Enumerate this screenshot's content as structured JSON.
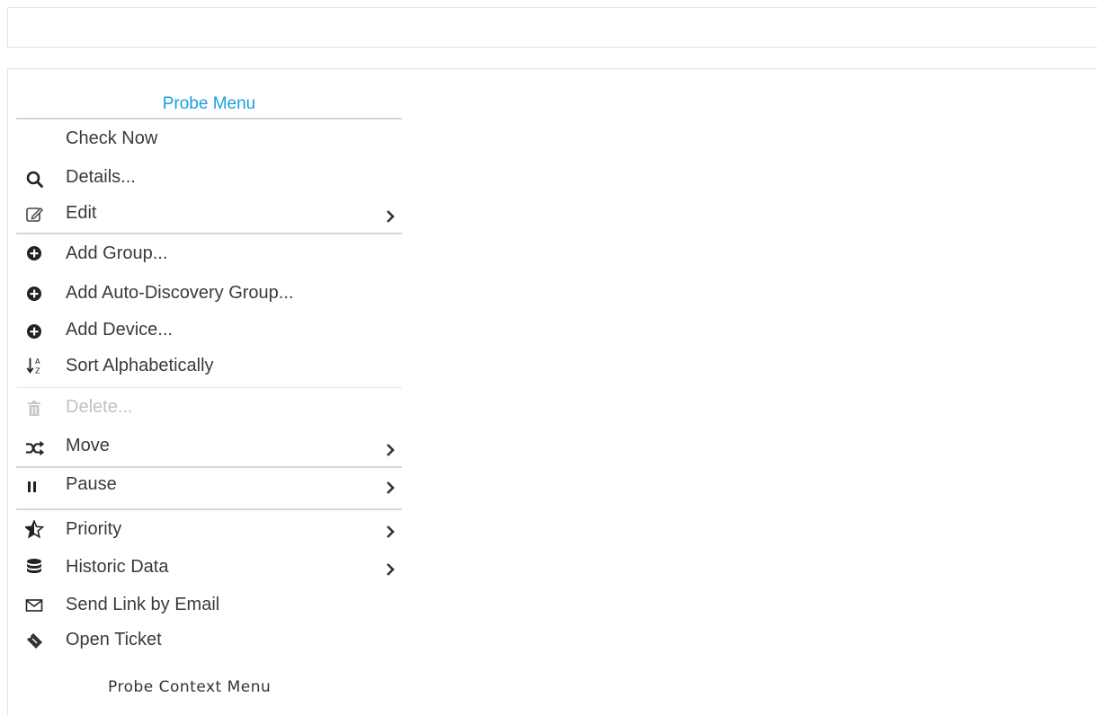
{
  "menu": {
    "title": "Probe Menu",
    "items": [
      {
        "label": "Check Now"
      },
      {
        "label": "Details..."
      },
      {
        "label": "Edit"
      },
      {
        "label": "Add Group..."
      },
      {
        "label": "Add Auto-Discovery Group..."
      },
      {
        "label": "Add Device..."
      },
      {
        "label": "Sort Alphabetically"
      },
      {
        "label": "Delete..."
      },
      {
        "label": "Move"
      },
      {
        "label": "Pause"
      },
      {
        "label": "Priority"
      },
      {
        "label": "Historic Data"
      },
      {
        "label": "Send Link by Email"
      },
      {
        "label": "Open Ticket"
      }
    ]
  },
  "caption": "Probe Context Menu",
  "colors": {
    "accent": "#1a9fe0",
    "text": "#3a3a3a",
    "disabled": "#c2c2c2",
    "divider": "#d6d6d6"
  }
}
